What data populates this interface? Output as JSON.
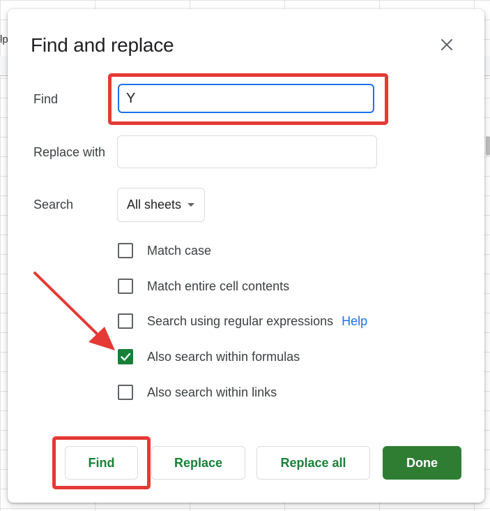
{
  "background": {
    "menu_fragment": "lp"
  },
  "dialog": {
    "title": "Find and replace",
    "close_icon": "close-icon"
  },
  "find": {
    "label": "Find",
    "value": "Y"
  },
  "replace": {
    "label": "Replace with",
    "value": ""
  },
  "search": {
    "label": "Search",
    "selected": "All sheets"
  },
  "options": {
    "match_case": {
      "label": "Match case",
      "checked": false
    },
    "match_entire": {
      "label": "Match entire cell contents",
      "checked": false
    },
    "regex": {
      "label": "Search using regular expressions",
      "checked": false,
      "help": "Help"
    },
    "formulas": {
      "label": "Also search within formulas",
      "checked": true
    },
    "links": {
      "label": "Also search within links",
      "checked": false
    }
  },
  "buttons": {
    "find": "Find",
    "replace": "Replace",
    "replace_all": "Replace all",
    "done": "Done"
  },
  "colors": {
    "accent_green": "#188038",
    "done_green": "#2e7d32",
    "focus_blue": "#1a73e8",
    "annotation_red": "#e53935"
  }
}
